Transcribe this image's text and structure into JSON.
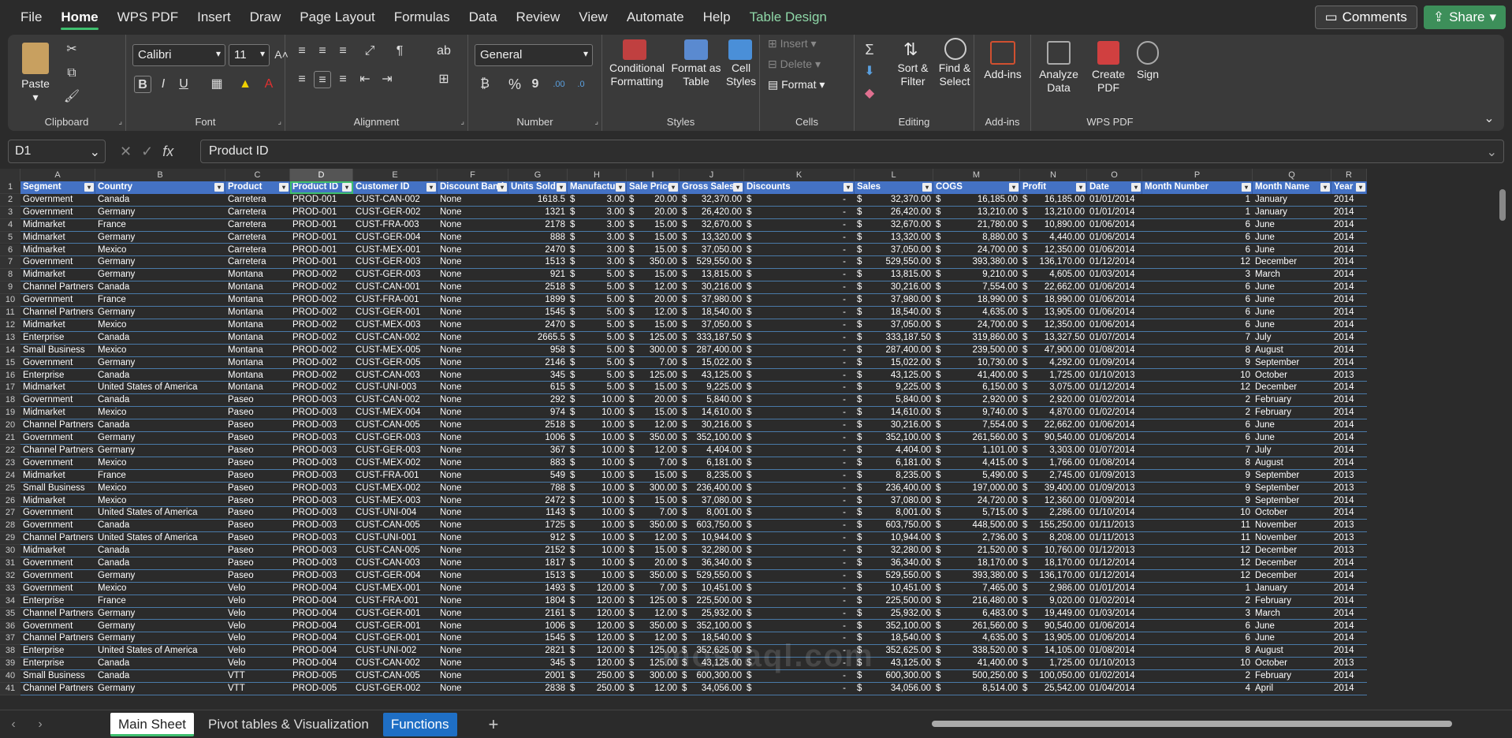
{
  "menu": [
    "File",
    "Home",
    "WPS PDF",
    "Insert",
    "Draw",
    "Page Layout",
    "Formulas",
    "Data",
    "Review",
    "View",
    "Automate",
    "Help",
    "Table Design"
  ],
  "actions": {
    "comments": "Comments",
    "share": "Share"
  },
  "ribbon": {
    "clipboard": {
      "paste": "Paste",
      "label": "Clipboard"
    },
    "font": {
      "name": "Calibri",
      "size": "11",
      "label": "Font",
      "bold": "B",
      "italic": "I",
      "underline": "U"
    },
    "alignment": {
      "label": "Alignment"
    },
    "number": {
      "format": "General",
      "label": "Number",
      "percent": "%",
      "comma": "9"
    },
    "styles": {
      "cond": "Conditional Formatting",
      "table": "Format as Table",
      "cell": "Cell Styles",
      "label": "Styles"
    },
    "cells": {
      "insert": "Insert",
      "delete": "Delete",
      "format": "Format",
      "label": "Cells"
    },
    "editing": {
      "sort": "Sort & Filter",
      "find": "Find & Select",
      "label": "Editing"
    },
    "addins": {
      "btn": "Add-ins",
      "label": "Add-ins"
    },
    "wps": {
      "analyze": "Analyze Data",
      "create": "Create PDF",
      "sign": "Sign",
      "label": "WPS PDF"
    }
  },
  "formula": {
    "namebox": "D1",
    "content": "Product ID"
  },
  "columns": [
    "A",
    "B",
    "C",
    "D",
    "E",
    "F",
    "G",
    "H",
    "I",
    "J",
    "K",
    "L",
    "M",
    "N",
    "O",
    "P",
    "Q",
    "R"
  ],
  "headers": [
    "Segment",
    "Country",
    "Product",
    "Product ID",
    "Customer ID",
    "Discount Band",
    "Units Sold",
    "Manufactur",
    "Sale Price",
    "Gross Sales",
    "Discounts",
    "Sales",
    "COGS",
    "Profit",
    "Date",
    "Month Number",
    "Month Name",
    "Year"
  ],
  "rows": [
    [
      "Government",
      "Canada",
      "Carretera",
      "PROD-001",
      "CUST-CAN-002",
      "None",
      "1618.5",
      "3.00",
      "20.00",
      "32,370.00",
      "-",
      "32,370.00",
      "16,185.00",
      "16,185.00",
      "01/01/2014",
      "1",
      "January",
      "2014"
    ],
    [
      "Government",
      "Germany",
      "Carretera",
      "PROD-001",
      "CUST-GER-002",
      "None",
      "1321",
      "3.00",
      "20.00",
      "26,420.00",
      "-",
      "26,420.00",
      "13,210.00",
      "13,210.00",
      "01/01/2014",
      "1",
      "January",
      "2014"
    ],
    [
      "Midmarket",
      "France",
      "Carretera",
      "PROD-001",
      "CUST-FRA-003",
      "None",
      "2178",
      "3.00",
      "15.00",
      "32,670.00",
      "-",
      "32,670.00",
      "21,780.00",
      "10,890.00",
      "01/06/2014",
      "6",
      "June",
      "2014"
    ],
    [
      "Midmarket",
      "Germany",
      "Carretera",
      "PROD-001",
      "CUST-GER-004",
      "None",
      "888",
      "3.00",
      "15.00",
      "13,320.00",
      "-",
      "13,320.00",
      "8,880.00",
      "4,440.00",
      "01/06/2014",
      "6",
      "June",
      "2014"
    ],
    [
      "Midmarket",
      "Mexico",
      "Carretera",
      "PROD-001",
      "CUST-MEX-001",
      "None",
      "2470",
      "3.00",
      "15.00",
      "37,050.00",
      "-",
      "37,050.00",
      "24,700.00",
      "12,350.00",
      "01/06/2014",
      "6",
      "June",
      "2014"
    ],
    [
      "Government",
      "Germany",
      "Carretera",
      "PROD-001",
      "CUST-GER-003",
      "None",
      "1513",
      "3.00",
      "350.00",
      "529,550.00",
      "-",
      "529,550.00",
      "393,380.00",
      "136,170.00",
      "01/12/2014",
      "12",
      "December",
      "2014"
    ],
    [
      "Midmarket",
      "Germany",
      "Montana",
      "PROD-002",
      "CUST-GER-003",
      "None",
      "921",
      "5.00",
      "15.00",
      "13,815.00",
      "-",
      "13,815.00",
      "9,210.00",
      "4,605.00",
      "01/03/2014",
      "3",
      "March",
      "2014"
    ],
    [
      "Channel Partners",
      "Canada",
      "Montana",
      "PROD-002",
      "CUST-CAN-001",
      "None",
      "2518",
      "5.00",
      "12.00",
      "30,216.00",
      "-",
      "30,216.00",
      "7,554.00",
      "22,662.00",
      "01/06/2014",
      "6",
      "June",
      "2014"
    ],
    [
      "Government",
      "France",
      "Montana",
      "PROD-002",
      "CUST-FRA-001",
      "None",
      "1899",
      "5.00",
      "20.00",
      "37,980.00",
      "-",
      "37,980.00",
      "18,990.00",
      "18,990.00",
      "01/06/2014",
      "6",
      "June",
      "2014"
    ],
    [
      "Channel Partners",
      "Germany",
      "Montana",
      "PROD-002",
      "CUST-GER-001",
      "None",
      "1545",
      "5.00",
      "12.00",
      "18,540.00",
      "-",
      "18,540.00",
      "4,635.00",
      "13,905.00",
      "01/06/2014",
      "6",
      "June",
      "2014"
    ],
    [
      "Midmarket",
      "Mexico",
      "Montana",
      "PROD-002",
      "CUST-MEX-003",
      "None",
      "2470",
      "5.00",
      "15.00",
      "37,050.00",
      "-",
      "37,050.00",
      "24,700.00",
      "12,350.00",
      "01/06/2014",
      "6",
      "June",
      "2014"
    ],
    [
      "Enterprise",
      "Canada",
      "Montana",
      "PROD-002",
      "CUST-CAN-002",
      "None",
      "2665.5",
      "5.00",
      "125.00",
      "333,187.50",
      "-",
      "333,187.50",
      "319,860.00",
      "13,327.50",
      "01/07/2014",
      "7",
      "July",
      "2014"
    ],
    [
      "Small Business",
      "Mexico",
      "Montana",
      "PROD-002",
      "CUST-MEX-005",
      "None",
      "958",
      "5.00",
      "300.00",
      "287,400.00",
      "-",
      "287,400.00",
      "239,500.00",
      "47,900.00",
      "01/08/2014",
      "8",
      "August",
      "2014"
    ],
    [
      "Government",
      "Germany",
      "Montana",
      "PROD-002",
      "CUST-GER-005",
      "None",
      "2146",
      "5.00",
      "7.00",
      "15,022.00",
      "-",
      "15,022.00",
      "10,730.00",
      "4,292.00",
      "01/09/2014",
      "9",
      "September",
      "2014"
    ],
    [
      "Enterprise",
      "Canada",
      "Montana",
      "PROD-002",
      "CUST-CAN-003",
      "None",
      "345",
      "5.00",
      "125.00",
      "43,125.00",
      "-",
      "43,125.00",
      "41,400.00",
      "1,725.00",
      "01/10/2013",
      "10",
      "October",
      "2013"
    ],
    [
      "Midmarket",
      "United States of America",
      "Montana",
      "PROD-002",
      "CUST-UNI-003",
      "None",
      "615",
      "5.00",
      "15.00",
      "9,225.00",
      "-",
      "9,225.00",
      "6,150.00",
      "3,075.00",
      "01/12/2014",
      "12",
      "December",
      "2014"
    ],
    [
      "Government",
      "Canada",
      "Paseo",
      "PROD-003",
      "CUST-CAN-002",
      "None",
      "292",
      "10.00",
      "20.00",
      "5,840.00",
      "-",
      "5,840.00",
      "2,920.00",
      "2,920.00",
      "01/02/2014",
      "2",
      "February",
      "2014"
    ],
    [
      "Midmarket",
      "Mexico",
      "Paseo",
      "PROD-003",
      "CUST-MEX-004",
      "None",
      "974",
      "10.00",
      "15.00",
      "14,610.00",
      "-",
      "14,610.00",
      "9,740.00",
      "4,870.00",
      "01/02/2014",
      "2",
      "February",
      "2014"
    ],
    [
      "Channel Partners",
      "Canada",
      "Paseo",
      "PROD-003",
      "CUST-CAN-005",
      "None",
      "2518",
      "10.00",
      "12.00",
      "30,216.00",
      "-",
      "30,216.00",
      "7,554.00",
      "22,662.00",
      "01/06/2014",
      "6",
      "June",
      "2014"
    ],
    [
      "Government",
      "Germany",
      "Paseo",
      "PROD-003",
      "CUST-GER-003",
      "None",
      "1006",
      "10.00",
      "350.00",
      "352,100.00",
      "-",
      "352,100.00",
      "261,560.00",
      "90,540.00",
      "01/06/2014",
      "6",
      "June",
      "2014"
    ],
    [
      "Channel Partners",
      "Germany",
      "Paseo",
      "PROD-003",
      "CUST-GER-003",
      "None",
      "367",
      "10.00",
      "12.00",
      "4,404.00",
      "-",
      "4,404.00",
      "1,101.00",
      "3,303.00",
      "01/07/2014",
      "7",
      "July",
      "2014"
    ],
    [
      "Government",
      "Mexico",
      "Paseo",
      "PROD-003",
      "CUST-MEX-002",
      "None",
      "883",
      "10.00",
      "7.00",
      "6,181.00",
      "-",
      "6,181.00",
      "4,415.00",
      "1,766.00",
      "01/08/2014",
      "8",
      "August",
      "2014"
    ],
    [
      "Midmarket",
      "France",
      "Paseo",
      "PROD-003",
      "CUST-FRA-001",
      "None",
      "549",
      "10.00",
      "15.00",
      "8,235.00",
      "-",
      "8,235.00",
      "5,490.00",
      "2,745.00",
      "01/09/2013",
      "9",
      "September",
      "2013"
    ],
    [
      "Small Business",
      "Mexico",
      "Paseo",
      "PROD-003",
      "CUST-MEX-002",
      "None",
      "788",
      "10.00",
      "300.00",
      "236,400.00",
      "-",
      "236,400.00",
      "197,000.00",
      "39,400.00",
      "01/09/2013",
      "9",
      "September",
      "2013"
    ],
    [
      "Midmarket",
      "Mexico",
      "Paseo",
      "PROD-003",
      "CUST-MEX-003",
      "None",
      "2472",
      "10.00",
      "15.00",
      "37,080.00",
      "-",
      "37,080.00",
      "24,720.00",
      "12,360.00",
      "01/09/2014",
      "9",
      "September",
      "2014"
    ],
    [
      "Government",
      "United States of America",
      "Paseo",
      "PROD-003",
      "CUST-UNI-004",
      "None",
      "1143",
      "10.00",
      "7.00",
      "8,001.00",
      "-",
      "8,001.00",
      "5,715.00",
      "2,286.00",
      "01/10/2014",
      "10",
      "October",
      "2014"
    ],
    [
      "Government",
      "Canada",
      "Paseo",
      "PROD-003",
      "CUST-CAN-005",
      "None",
      "1725",
      "10.00",
      "350.00",
      "603,750.00",
      "-",
      "603,750.00",
      "448,500.00",
      "155,250.00",
      "01/11/2013",
      "11",
      "November",
      "2013"
    ],
    [
      "Channel Partners",
      "United States of America",
      "Paseo",
      "PROD-003",
      "CUST-UNI-001",
      "None",
      "912",
      "10.00",
      "12.00",
      "10,944.00",
      "-",
      "10,944.00",
      "2,736.00",
      "8,208.00",
      "01/11/2013",
      "11",
      "November",
      "2013"
    ],
    [
      "Midmarket",
      "Canada",
      "Paseo",
      "PROD-003",
      "CUST-CAN-005",
      "None",
      "2152",
      "10.00",
      "15.00",
      "32,280.00",
      "-",
      "32,280.00",
      "21,520.00",
      "10,760.00",
      "01/12/2013",
      "12",
      "December",
      "2013"
    ],
    [
      "Government",
      "Canada",
      "Paseo",
      "PROD-003",
      "CUST-CAN-003",
      "None",
      "1817",
      "10.00",
      "20.00",
      "36,340.00",
      "-",
      "36,340.00",
      "18,170.00",
      "18,170.00",
      "01/12/2014",
      "12",
      "December",
      "2014"
    ],
    [
      "Government",
      "Germany",
      "Paseo",
      "PROD-003",
      "CUST-GER-004",
      "None",
      "1513",
      "10.00",
      "350.00",
      "529,550.00",
      "-",
      "529,550.00",
      "393,380.00",
      "136,170.00",
      "01/12/2014",
      "12",
      "December",
      "2014"
    ],
    [
      "Government",
      "Mexico",
      "Velo",
      "PROD-004",
      "CUST-MEX-001",
      "None",
      "1493",
      "120.00",
      "7.00",
      "10,451.00",
      "-",
      "10,451.00",
      "7,465.00",
      "2,986.00",
      "01/01/2014",
      "1",
      "January",
      "2014"
    ],
    [
      "Enterprise",
      "France",
      "Velo",
      "PROD-004",
      "CUST-FRA-001",
      "None",
      "1804",
      "120.00",
      "125.00",
      "225,500.00",
      "-",
      "225,500.00",
      "216,480.00",
      "9,020.00",
      "01/02/2014",
      "2",
      "February",
      "2014"
    ],
    [
      "Channel Partners",
      "Germany",
      "Velo",
      "PROD-004",
      "CUST-GER-001",
      "None",
      "2161",
      "120.00",
      "12.00",
      "25,932.00",
      "-",
      "25,932.00",
      "6,483.00",
      "19,449.00",
      "01/03/2014",
      "3",
      "March",
      "2014"
    ],
    [
      "Government",
      "Germany",
      "Velo",
      "PROD-004",
      "CUST-GER-001",
      "None",
      "1006",
      "120.00",
      "350.00",
      "352,100.00",
      "-",
      "352,100.00",
      "261,560.00",
      "90,540.00",
      "01/06/2014",
      "6",
      "June",
      "2014"
    ],
    [
      "Channel Partners",
      "Germany",
      "Velo",
      "PROD-004",
      "CUST-GER-001",
      "None",
      "1545",
      "120.00",
      "12.00",
      "18,540.00",
      "-",
      "18,540.00",
      "4,635.00",
      "13,905.00",
      "01/06/2014",
      "6",
      "June",
      "2014"
    ],
    [
      "Enterprise",
      "United States of America",
      "Velo",
      "PROD-004",
      "CUST-UNI-002",
      "None",
      "2821",
      "120.00",
      "125.00",
      "352,625.00",
      "-",
      "352,625.00",
      "338,520.00",
      "14,105.00",
      "01/08/2014",
      "8",
      "August",
      "2014"
    ],
    [
      "Enterprise",
      "Canada",
      "Velo",
      "PROD-004",
      "CUST-CAN-002",
      "None",
      "345",
      "120.00",
      "125.00",
      "43,125.00",
      "-",
      "43,125.00",
      "41,400.00",
      "1,725.00",
      "01/10/2013",
      "10",
      "October",
      "2013"
    ],
    [
      "Small Business",
      "Canada",
      "VTT",
      "PROD-005",
      "CUST-CAN-005",
      "None",
      "2001",
      "250.00",
      "300.00",
      "600,300.00",
      "-",
      "600,300.00",
      "500,250.00",
      "100,050.00",
      "01/02/2014",
      "2",
      "February",
      "2014"
    ],
    [
      "Channel Partners",
      "Germany",
      "VTT",
      "PROD-005",
      "CUST-GER-002",
      "None",
      "2838",
      "250.00",
      "12.00",
      "34,056.00",
      "-",
      "34,056.00",
      "8,514.00",
      "25,542.00",
      "01/04/2014",
      "4",
      "April",
      "2014"
    ]
  ],
  "sheets": [
    "Main Sheet",
    "Pivot tables & Visualization",
    "Functions"
  ],
  "watermark": "mostaql.com"
}
